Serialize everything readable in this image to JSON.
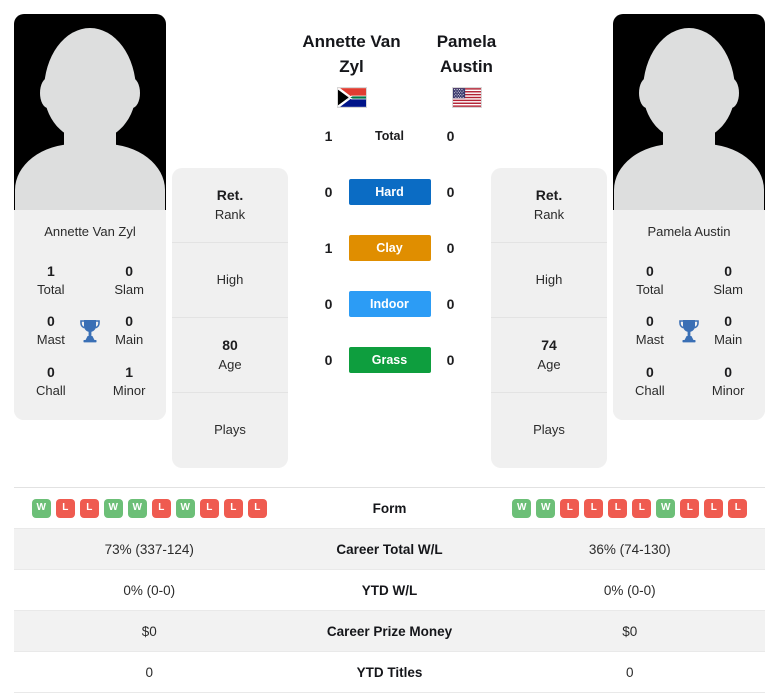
{
  "players": {
    "left": {
      "name_line1": "Annette Van",
      "name_line2": "Zyl",
      "full_name": "Annette Van Zyl",
      "flag": "south-africa-flag",
      "titles": {
        "total_value": "1",
        "total_label": "Total",
        "slam_value": "0",
        "slam_label": "Slam",
        "mast_value": "0",
        "mast_label": "Mast",
        "main_value": "0",
        "main_label": "Main",
        "chall_value": "0",
        "chall_label": "Chall",
        "minor_value": "1",
        "minor_label": "Minor",
        "trophy_icon": "trophy-icon"
      },
      "info": {
        "rank_value": "Ret.",
        "rank_label": "Rank",
        "high_value": "",
        "high_label": "High",
        "age_value": "80",
        "age_label": "Age",
        "plays_value": "",
        "plays_label": "Plays"
      },
      "form": [
        "W",
        "L",
        "L",
        "W",
        "W",
        "L",
        "W",
        "L",
        "L",
        "L"
      ],
      "career_wl": "73% (337-124)",
      "ytd_wl": "0% (0-0)",
      "prize_money": "$0",
      "ytd_titles": "0"
    },
    "right": {
      "name_line1": "Pamela",
      "name_line2": "Austin",
      "full_name": "Pamela Austin",
      "flag": "usa-flag",
      "titles": {
        "total_value": "0",
        "total_label": "Total",
        "slam_value": "0",
        "slam_label": "Slam",
        "mast_value": "0",
        "mast_label": "Mast",
        "main_value": "0",
        "main_label": "Main",
        "chall_value": "0",
        "chall_label": "Chall",
        "minor_value": "0",
        "minor_label": "Minor",
        "trophy_icon": "trophy-icon"
      },
      "info": {
        "rank_value": "Ret.",
        "rank_label": "Rank",
        "high_value": "",
        "high_label": "High",
        "age_value": "74",
        "age_label": "Age",
        "plays_value": "",
        "plays_label": "Plays"
      },
      "form": [
        "W",
        "W",
        "L",
        "L",
        "L",
        "L",
        "W",
        "L",
        "L",
        "L"
      ],
      "career_wl": "36% (74-130)",
      "ytd_wl": "0% (0-0)",
      "prize_money": "$0",
      "ytd_titles": "0"
    }
  },
  "h2h": {
    "rows": [
      {
        "label": "Total",
        "left": "1",
        "right": "0",
        "color": "none",
        "style": "plain"
      },
      {
        "label": "Hard",
        "left": "0",
        "right": "0",
        "color": "#0b6cc4",
        "style": "badge"
      },
      {
        "label": "Clay",
        "left": "1",
        "right": "0",
        "color": "#e08e00",
        "style": "badge"
      },
      {
        "label": "Indoor",
        "left": "0",
        "right": "0",
        "color": "#2c9cf5",
        "style": "badge"
      },
      {
        "label": "Grass",
        "left": "0",
        "right": "0",
        "color": "#0e9e3e",
        "style": "badge"
      }
    ]
  },
  "table": {
    "rows": [
      {
        "label": "Form",
        "type": "form",
        "left": "",
        "right": "",
        "alt": false
      },
      {
        "label": "Career Total W/L",
        "type": "text",
        "left": "73% (337-124)",
        "right": "36% (74-130)",
        "alt": true
      },
      {
        "label": "YTD W/L",
        "type": "text",
        "left": "0% (0-0)",
        "right": "0% (0-0)",
        "alt": false
      },
      {
        "label": "Career Prize Money",
        "type": "text",
        "left": "$0",
        "right": "$0",
        "alt": true
      },
      {
        "label": "YTD Titles",
        "type": "text",
        "left": "0",
        "right": "0",
        "alt": false
      }
    ]
  },
  "colors": {
    "hard": "#0b6cc4",
    "clay": "#e08e00",
    "indoor": "#2c9cf5",
    "grass": "#0e9e3e",
    "win": "#6cbf77",
    "loss": "#ef5b50",
    "trophy": "#3a6fb5"
  }
}
